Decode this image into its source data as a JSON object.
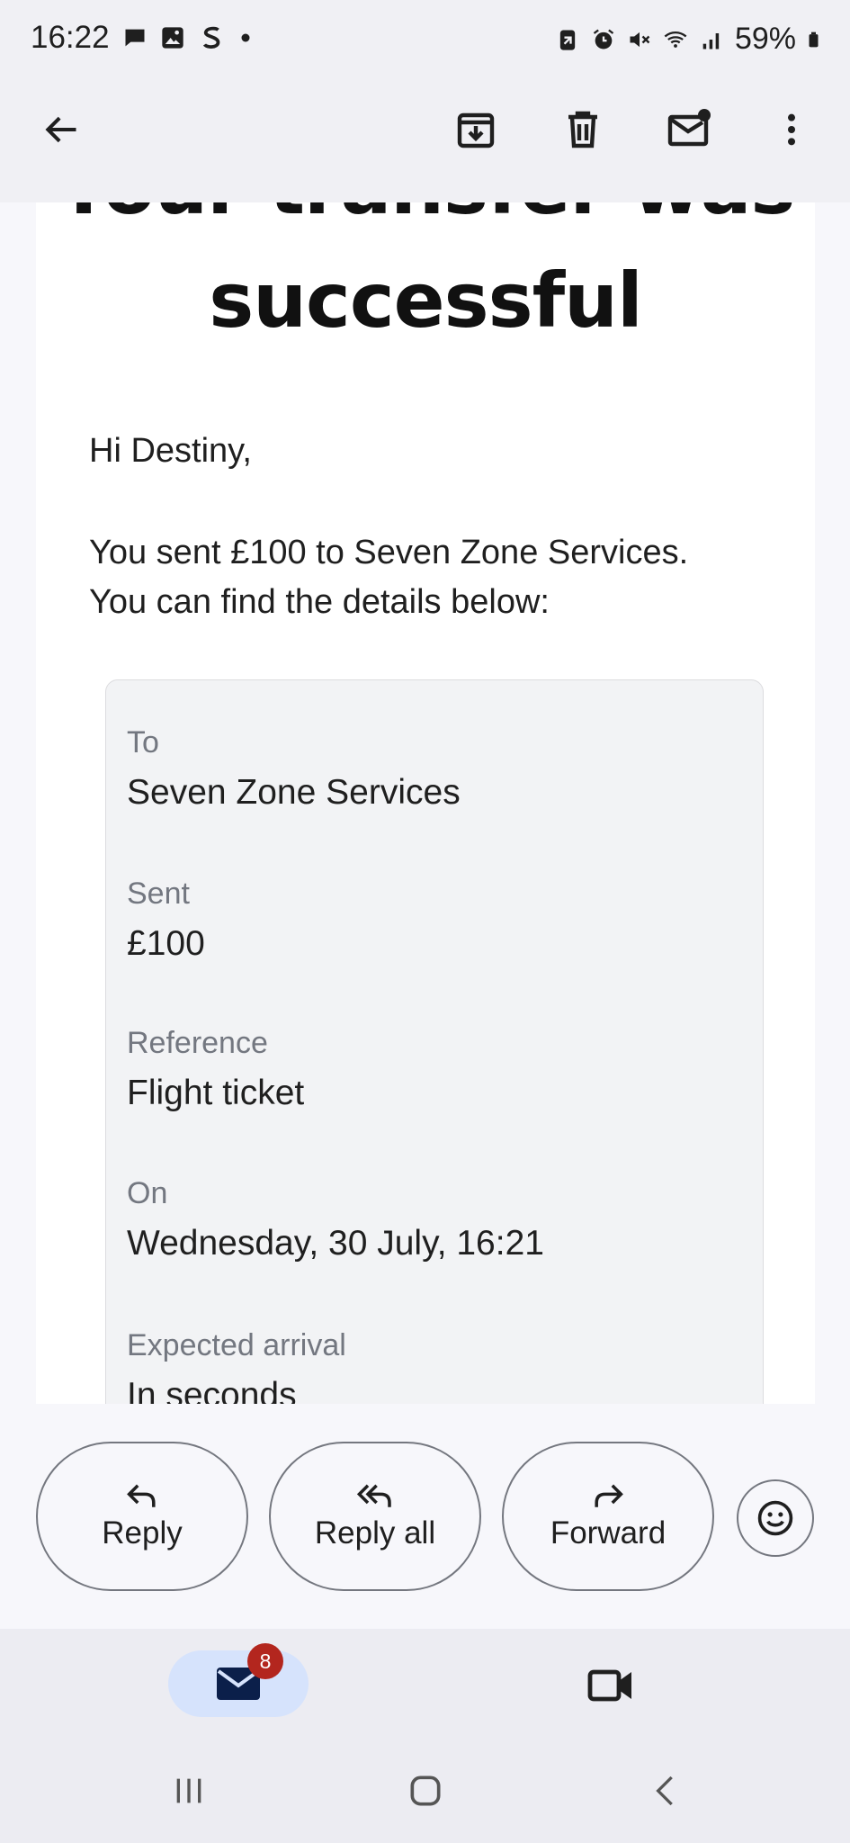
{
  "status_bar": {
    "time": "16:22",
    "battery": "59%",
    "left_icons": [
      "chat-icon",
      "gallery-icon",
      "s-app-icon",
      "dot-icon"
    ],
    "right_icons": [
      "battery-saver-icon",
      "alarm-icon",
      "mute-icon",
      "wifi-icon",
      "signal-icon",
      "battery-icon"
    ]
  },
  "app_bar": {
    "icons": [
      "back-arrow-icon",
      "archive-icon",
      "delete-icon",
      "mark-unread-icon",
      "more-vert-icon"
    ]
  },
  "email": {
    "headline_line1": "Your transfer was",
    "headline_line2": "successful",
    "greeting": "Hi Destiny,",
    "body_line1": "You sent £100 to Seven Zone Services.",
    "body_line2": "You can find the details below:",
    "details": [
      {
        "label": "To",
        "value": "Seven Zone Services"
      },
      {
        "label": "Sent",
        "value": "£100"
      },
      {
        "label": "Reference",
        "value": "Flight ticket"
      },
      {
        "label": "On",
        "value": "Wednesday, 30 July, 16:21"
      },
      {
        "label": "Expected arrival",
        "value": "In seconds"
      }
    ]
  },
  "actions": {
    "reply": "Reply",
    "reply_all": "Reply all",
    "forward": "Forward"
  },
  "bottom_nav": {
    "mail_badge": "8"
  },
  "colors": {
    "badge": "#b3261e",
    "active_tab": "#d6e3fc",
    "label_gray": "#737780"
  }
}
